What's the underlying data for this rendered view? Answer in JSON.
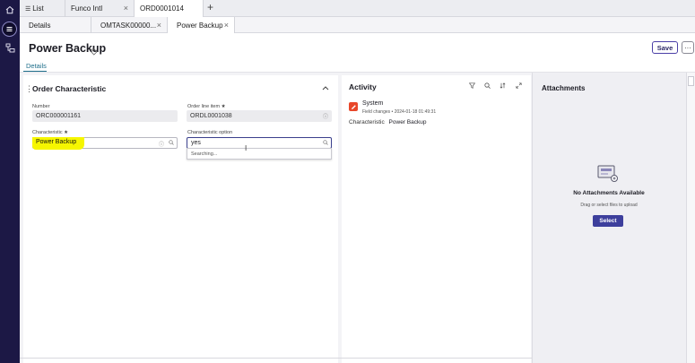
{
  "top_tabs": [
    {
      "label": "List",
      "icon": "list-icon"
    },
    {
      "label": "Funco Intl"
    },
    {
      "label": "ORD0001014"
    }
  ],
  "sub_tabs": [
    {
      "label": "Details"
    },
    {
      "label": "OMTASK00000..."
    },
    {
      "label": "Power Backup"
    }
  ],
  "header": {
    "title": "Power Backup",
    "save_label": "Save",
    "more_label": "···",
    "details_tab": "Details"
  },
  "order_characteristic": {
    "title": "Order Characteristic",
    "number_label": "Number",
    "number_value": "ORC000001161",
    "order_line_label": "Order line item",
    "order_line_value": "ORDL0001038",
    "characteristic_label": "Characteristic",
    "characteristic_value": "Power Backup",
    "option_label": "Characteristic option",
    "option_value": "yes",
    "dropdown_status": "Searching...",
    "required_mark": "★"
  },
  "activity": {
    "title": "Activity",
    "entry": {
      "author": "System",
      "meta_type": "Field changes",
      "meta_time": "2024-01-18 01:49:31",
      "field": "Characteristic",
      "value": "Power Backup"
    }
  },
  "attachments": {
    "title": "Attachments",
    "empty_title": "No Attachments Available",
    "hint": "Drag or select files to upload",
    "select_label": "Select"
  },
  "colors": {
    "rail": "#1c1845",
    "accent": "#3d3f9c",
    "highlight": "#f6f600",
    "activity_badge": "#e8472a"
  }
}
